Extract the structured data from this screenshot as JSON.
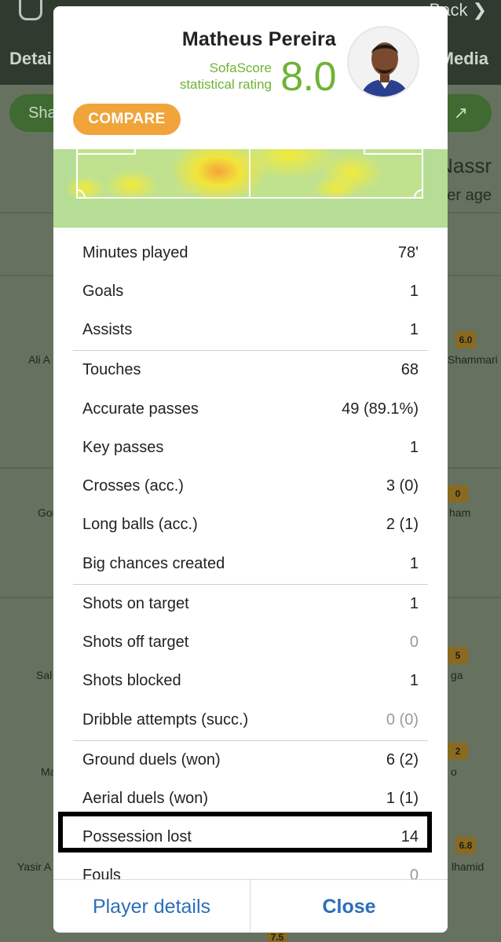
{
  "background": {
    "tab_left": "Detai",
    "tab_right": "Media",
    "back_label": "Back",
    "share_label": "Sha",
    "team_label": "Nassr",
    "age_label": "yer age",
    "names": [
      "Ali A",
      "Gor",
      "Sal",
      "Ma",
      "Yasir A",
      "Shammari",
      "ham",
      "ga",
      "o",
      "lhamid"
    ],
    "badges": [
      "6.0",
      "0",
      "5",
      "2",
      "6.8",
      "7.5"
    ]
  },
  "modal": {
    "player_name": "Matheus Pereira",
    "rating_label_line1": "SofaScore",
    "rating_label_line2": "statistical rating",
    "rating_value": "8.0",
    "compare_label": "COMPARE",
    "stats": [
      {
        "label": "Minutes played",
        "value": "78'"
      },
      {
        "label": "Goals",
        "value": "1"
      },
      {
        "label": "Assists",
        "value": "1"
      },
      {
        "label": "Touches",
        "value": "68"
      },
      {
        "label": "Accurate passes",
        "value": "49 (89.1%)"
      },
      {
        "label": "Key passes",
        "value": "1"
      },
      {
        "label": "Crosses (acc.)",
        "value": "3 (0)"
      },
      {
        "label": "Long balls (acc.)",
        "value": "2 (1)"
      },
      {
        "label": "Big chances created",
        "value": "1"
      },
      {
        "label": "Shots on target",
        "value": "1"
      },
      {
        "label": "Shots off target",
        "value": "0"
      },
      {
        "label": "Shots blocked",
        "value": "1"
      },
      {
        "label": "Dribble attempts (succ.)",
        "value": "0 (0)"
      },
      {
        "label": "Ground duels (won)",
        "value": "6 (2)"
      },
      {
        "label": "Aerial duels (won)",
        "value": "1 (1)"
      },
      {
        "label": "Possession lost",
        "value": "14"
      },
      {
        "label": "Fouls",
        "value": "0"
      }
    ],
    "footer": {
      "details_label": "Player details",
      "close_label": "Close"
    }
  },
  "colors": {
    "rating_green": "#6fb334",
    "compare_orange": "#f0a43a",
    "link_blue": "#2a6eb8",
    "muted_value": "#9a9a9a"
  }
}
